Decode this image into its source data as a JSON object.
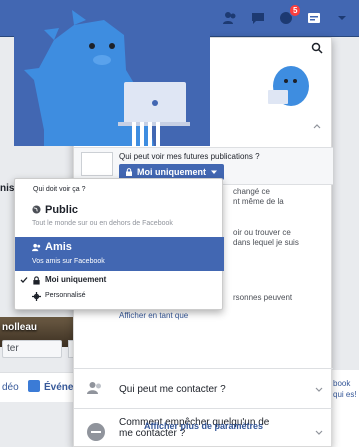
{
  "topbar": {
    "notification_count": "5",
    "icons": [
      "friends-icon",
      "messages-icon",
      "notifications-icon",
      "privacy-shortcuts-icon",
      "account-menu-icon"
    ]
  },
  "background": {
    "left_text": "nis",
    "photo_label": "nolleau",
    "photo_btn": "ter",
    "video_label": "déo",
    "event_label": "Événe",
    "right_text": "book qui es!"
  },
  "privacy_panel": {
    "future_posts_question": "Qui peut voir mes futures publications ?",
    "audience_button": "Moi uniquement",
    "row1_desc": "changé ce\nnt même de la",
    "row2_desc": "oir ou trouver ce\ndans lequel je suis",
    "row3_desc": "rsonnes peuvent",
    "afficher_en_tant_que": "Afficher en tant que",
    "contact_question": "Qui peut me contacter ?",
    "block_question": "Comment empêcher quelqu'un de me contacter ?",
    "more_settings": "Afficher plus de paramètres"
  },
  "audience_dropdown": {
    "title": "Qui doit voir ça ?",
    "options": [
      {
        "label": "Public",
        "desc": "Tout le monde sur ou en dehors de Facebook",
        "icon": "globe-icon",
        "selected": false,
        "highlighted": false
      },
      {
        "label": "Amis",
        "desc": "Vos amis sur Facebook",
        "icon": "friends-icon",
        "selected": false,
        "highlighted": true
      },
      {
        "label": "Moi uniquement",
        "desc": "",
        "icon": "lock-icon",
        "selected": true,
        "highlighted": false
      },
      {
        "label": "Personnalisé",
        "desc": "",
        "icon": "gear-icon",
        "selected": false,
        "highlighted": false
      }
    ]
  },
  "colors": {
    "facebook_blue": "#4267b2",
    "link_blue": "#365899",
    "badge_red": "#fa3e3e",
    "dino_blue": "#3e8de0"
  }
}
